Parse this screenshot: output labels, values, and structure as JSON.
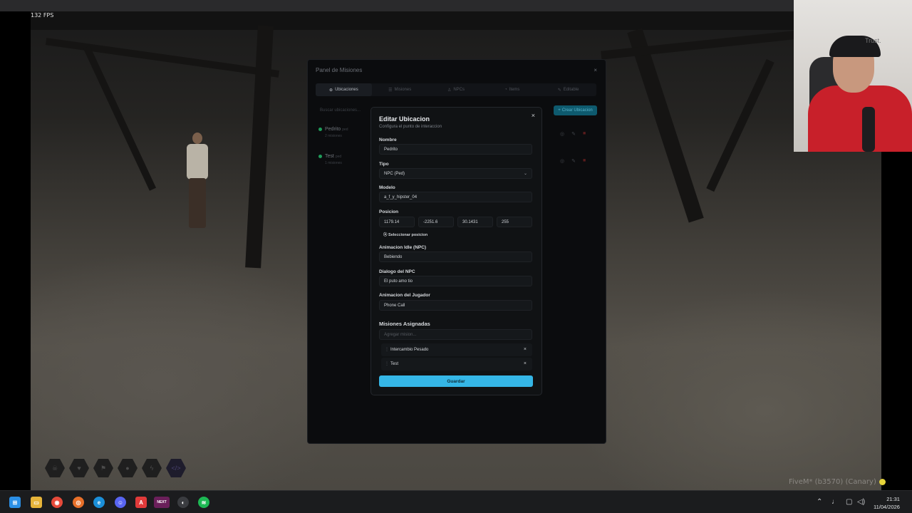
{
  "game": {
    "fps_label": "132 FPS",
    "fivem_label": "FiveM* (b3570) (Canary)"
  },
  "webcam": {
    "overlay_text": "Trust."
  },
  "panel": {
    "title": "Panel de Misiones",
    "close": "×",
    "tabs": [
      {
        "label": "Ubicaciones",
        "icon": "⊕",
        "active": true
      },
      {
        "label": "Misiones",
        "icon": "☰"
      },
      {
        "label": "NPCs",
        "icon": "♙"
      },
      {
        "label": "Items",
        "icon": "◔"
      },
      {
        "label": "Editable",
        "icon": "✎"
      }
    ],
    "search_placeholder": "Buscar ubicaciones...",
    "create_button": "Crear Ubicacion",
    "locations": [
      {
        "name": "Pedrito",
        "tag": "ped",
        "sub": "2 misiones"
      },
      {
        "name": "Test",
        "tag": "ped",
        "sub": "1 misiones"
      }
    ]
  },
  "modal": {
    "title": "Editar Ubicacion",
    "subtitle": "Configura el punto de interaccion",
    "close": "×",
    "fields": {
      "nombre_label": "Nombre",
      "nombre_value": "Pedrito",
      "tipo_label": "Tipo",
      "tipo_value": "NPC (Ped)",
      "modelo_label": "Modelo",
      "modelo_value": "a_f_y_hipster_04",
      "posicion_label": "Posicion",
      "pos_x": "1179.14",
      "pos_y": "-2251.6",
      "pos_z": "30.1431",
      "pos_h": "255",
      "select_position": "Seleccionar posicion",
      "anim_idle_label": "Animacion Idle (NPC)",
      "anim_idle_value": "Bebiendo",
      "dialogo_label": "Dialogo del NPC",
      "dialogo_value": "El puto amo tio",
      "anim_jugador_label": "Animacion del Jugador",
      "anim_jugador_value": "Phone Call",
      "misiones_label": "Misiones Asignadas",
      "add_mission_placeholder": "Agregar mision..."
    },
    "missions": [
      {
        "label": "Intercambio Pesado",
        "remove": "×"
      },
      {
        "label": "Test",
        "remove": "×"
      }
    ],
    "save_button": "Guardar"
  },
  "hotbar": [
    "skull-icon",
    "heart-icon",
    "food-icon",
    "water-icon",
    "energy-icon",
    "code-icon"
  ],
  "taskbar": {
    "time": "21:31",
    "date": "11/04/2026"
  },
  "colors": {
    "accent": "#35b6e6",
    "status_green": "#1f9c5a",
    "modal_bg": "#101214"
  }
}
